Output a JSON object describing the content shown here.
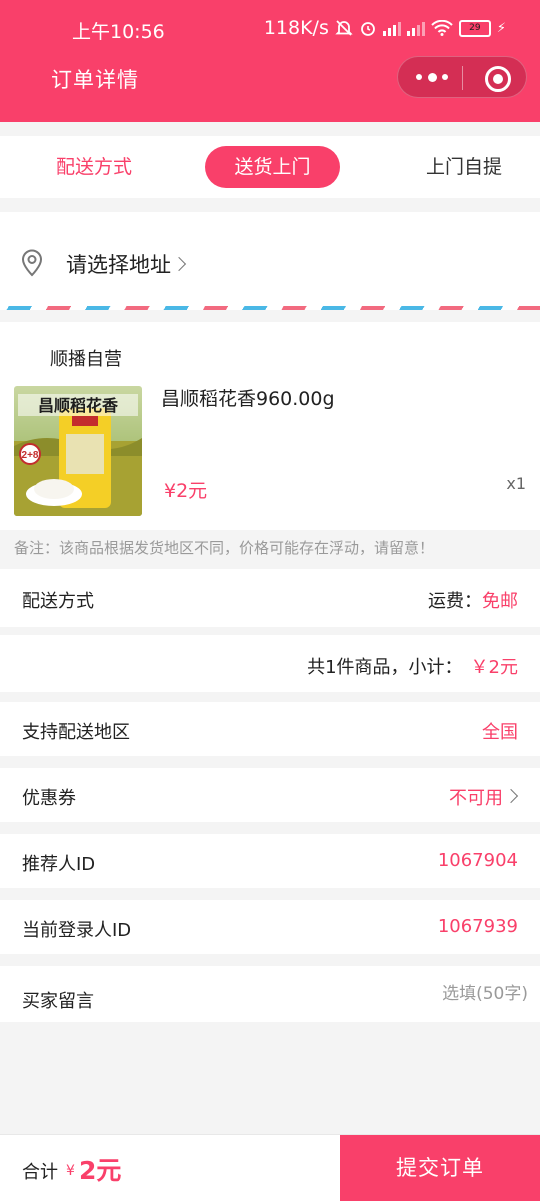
{
  "status_bar": {
    "time": "上午10:56",
    "network_speed": "118K/s",
    "battery_level": "29"
  },
  "header": {
    "title": "订单详情",
    "brand_color": "#f9406a"
  },
  "delivery_tabs": {
    "label": "配送方式",
    "options": [
      "送货上门",
      "上门自提"
    ],
    "selected": "送货上门"
  },
  "address": {
    "placeholder": "请选择地址"
  },
  "order": {
    "shop_name": "顺播自营",
    "product": {
      "name": "昌顺稻花香960.00g",
      "price": "¥2元",
      "quantity": "x1",
      "image_label": "昌顺稻花香",
      "image_badge": "2+8"
    },
    "note": "备注：该商品根据发货地区不同，价格可能存在浮动，请留意！"
  },
  "shipping": {
    "label": "配送方式",
    "fee_label": "运费：",
    "fee_value": "免邮"
  },
  "summary": {
    "text": "共1件商品，小计：",
    "amount": "￥2元"
  },
  "rows": {
    "region_label": "支持配送地区",
    "region_value": "全国",
    "coupon_label": "优惠券",
    "coupon_value": "不可用",
    "referrer_label": "推荐人ID",
    "referrer_value": "1067904",
    "login_label": "当前登录人ID",
    "login_value": "1067939",
    "message_label": "买家留言",
    "message_placeholder": "选填(50字)"
  },
  "footer": {
    "total_label": "合计",
    "currency": "¥",
    "total_value": "2元",
    "submit_label": "提交订单"
  }
}
